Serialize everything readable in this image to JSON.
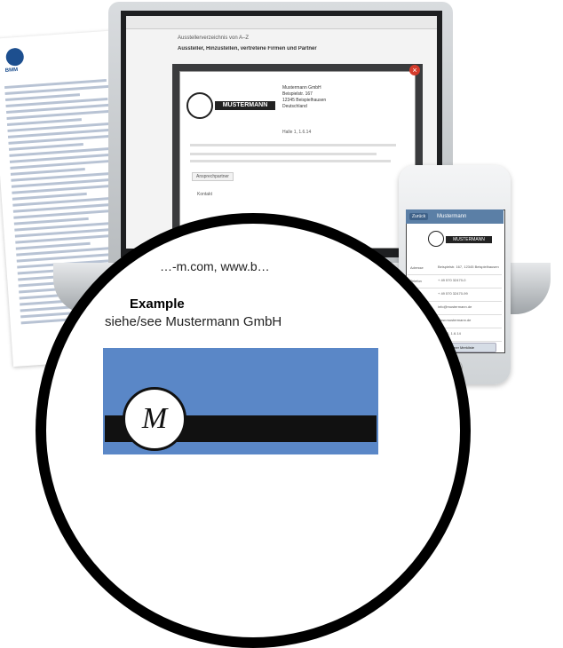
{
  "brochure": {
    "brand": "BMM"
  },
  "window": {
    "breadcrumb": "Ausstellerverzeichnis von A–Z",
    "heading": "Aussteller, Hinzustellen, vertretene Firmen und Partner"
  },
  "modal": {
    "close_label": "×",
    "logo_text": "MUSTERMANN",
    "address": [
      "Mustermann GmbH",
      "Beispielstr. 167",
      "12345 Beispielhausen",
      "Deutschland"
    ],
    "stand_label": "Halle 1, 1.6.14",
    "tab_label": "Ansprechpartner",
    "button_label": "Kontakt"
  },
  "phone": {
    "back_label": "Zurück",
    "title": "Mustermann",
    "logo_text": "MUSTERMANN",
    "rows": [
      {
        "k": "Adresse",
        "v": "Beispielstr. 167, 12345 Beispielhausen"
      },
      {
        "k": "Telefon",
        "v": "+ 49 570 32470-0"
      },
      {
        "k": "Telefax",
        "v": "+ 49 570 32470-99"
      },
      {
        "k": "E-Mail",
        "v": "info@mustermann.de"
      },
      {
        "k": "Internet",
        "v": "www.mustermann.de"
      },
      {
        "k": "Stand",
        "v": "Halle 1, 1.6.14"
      }
    ],
    "button_label": "+ zu meiner Merkliste"
  },
  "lens": {
    "url_text": "…-m.com, www.b…",
    "example": "Example",
    "siehe": "siehe/see Mustermann GmbH",
    "logo_glyph": "M"
  }
}
